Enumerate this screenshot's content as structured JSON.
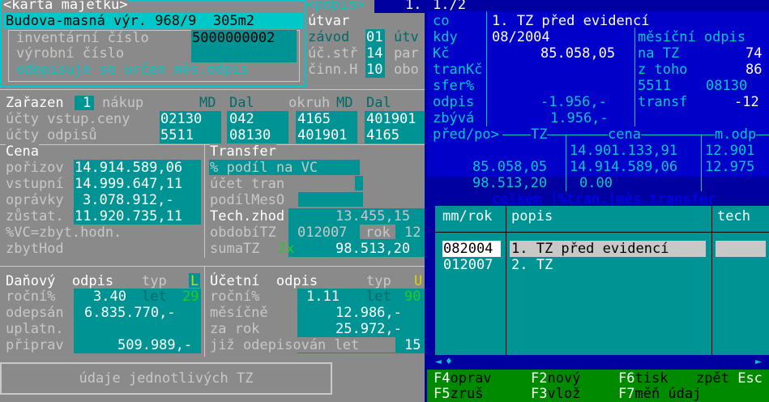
{
  "card": {
    "frame_title": "<karta majetku>",
    "name": "Budova-masná výr. 968/9  305m2",
    "inv_label": "inventární číslo",
    "inv_value": "5000000002",
    "prod_label": "výrobní číslo",
    "prod_value": "",
    "depr_note": "odepisuje se určen měs.odpis"
  },
  "right_top": {
    "popis_tag": "popis",
    "utvar_label": "útvar",
    "zavod_label": "závod",
    "zavod_value": "01",
    "utv_label": "útv",
    "ucstr_label": "úč.stř",
    "ucstr_value": "14",
    "par_label": "par",
    "cinn_label": "činn.H",
    "cinn_value": "10",
    "obo_label": "obo"
  },
  "zarazen": {
    "label": "Zařazen",
    "value": "1",
    "mode": "nákup",
    "md": "MD",
    "dal": "Dal",
    "okruh": "okruh",
    "md2": "MD",
    "dal2": "Dal",
    "row1_label": "účty vstup.ceny",
    "row1": [
      "02130",
      "042",
      "4165",
      "401901"
    ],
    "row2_label": "účty odpisů",
    "row2": [
      "5511",
      "08130",
      "401901",
      "4165"
    ]
  },
  "cena": {
    "title": "Cena",
    "rows": [
      {
        "label": "pořizov",
        "value": "14.914.589,06"
      },
      {
        "label": "vstupní",
        "value": "14.999.647,11"
      },
      {
        "label": "oprávky",
        "value": "3.078.912,-"
      },
      {
        "label": "zůstat.",
        "value": "11.920.735,11"
      }
    ],
    "vc_note": "%VC=zbyt.hodn.",
    "zbyt_label": "zbytHod"
  },
  "transfer": {
    "title": "Transfer",
    "podil": "% podíl na VC",
    "ucet": "účet tran",
    "podilmes": "podílMesO",
    "techzhod_label": "Tech.zhod",
    "techzhod_value": "13.455,15",
    "obdobi_label": "obdobíTZ",
    "obdobi_value": "012007",
    "rok_label": "rok",
    "rok_value": "12",
    "suma_label": "sumaTZ",
    "suma_mult": "2x",
    "suma_value": "98.513,20"
  },
  "danovy": {
    "title": "Daňový  odpis",
    "typ_label": "typ",
    "typ_value": "L",
    "rocni_label": "roční%",
    "rocni_value": "3.40",
    "let_label": "let",
    "let_value": "29",
    "odepsan_label": "odepsán",
    "odepsan_value": "6.835.770,-",
    "uplatn_label": "uplatn.",
    "priprav_label": "připrav",
    "priprav_value": "509.989,-"
  },
  "ucetni": {
    "title": "Účetní  odpis",
    "typ_label": "typ",
    "typ_value": "U",
    "rocni_label": "roční%",
    "rocni_value": "1.11",
    "let_label": "let",
    "let_value": "90",
    "mesicne_label": "měsíčně",
    "mesicne_value": "12.986,-",
    "zarok_label": "za rok",
    "zarok_value": "25.972,-",
    "jiz_label": "již odepisován let",
    "jiz_value": "15"
  },
  "tz_button": "údaje jednotlivých TZ",
  "tz": {
    "counter": "1./2",
    "co_label": "co",
    "co_value": "1. TZ před evidencí",
    "kdy_label": "kdy",
    "kdy_value": "08/2004",
    "mes_odpis_label": "měsíční odpis",
    "kc_label": "Kč",
    "kc_value": "85.058,05",
    "natz_label": "na TZ",
    "natz_value": "74",
    "tran_label": "tranKč",
    "ztoho_label": "z toho",
    "ztoho_value": "86",
    "sfer_label": "sfer%",
    "acc1": "5511",
    "acc2": "08130",
    "odpis_label": "odpis",
    "odpis_value": "-1.956,-",
    "transf_label": "transf",
    "transf_value": "-12",
    "zbyva_label": "zbývá",
    "zbyva_value": "1.956,-",
    "pred_label": "před/po>",
    "tz_col": "TZ",
    "cena_col": "cena",
    "modp_col": "m.odp",
    "row_a": [
      "14.901.133,91",
      "12.901"
    ],
    "row_b": [
      "85.058,05",
      "14.914.589,06",
      "12.975"
    ],
    "row_c": [
      "98.513,20",
      "0.00"
    ],
    "footer": "celkem │%tran.│měs.transfer"
  },
  "list": {
    "headers": [
      "mm/rok",
      "popis",
      "tech"
    ],
    "rows": [
      {
        "date": "082004",
        "desc": "1. TZ před evidencí",
        "tech": ""
      },
      {
        "date": "012007",
        "desc": "2. TZ",
        "tech": ""
      }
    ]
  },
  "fkeys": {
    "row1": [
      {
        "key": "F4",
        "label": "oprav"
      },
      {
        "key": "F2",
        "label": "nový"
      },
      {
        "key": "F6",
        "label": "tisk"
      }
    ],
    "row2": [
      {
        "key": "F5",
        "label": "zruš"
      },
      {
        "key": "F3",
        "label": "vlož"
      },
      {
        "key": "F7",
        "label": "měň údaj"
      }
    ],
    "exit_label": "zpět",
    "exit_key": "Esc"
  },
  "colors": {
    "teal": "#009393",
    "dark_teal": "#006f6f",
    "blue": "#0000c8",
    "gray": "#8a8a8a",
    "cyan": "#00c8c8",
    "green": "#22cc22",
    "fkey_bar": "#008a00"
  }
}
